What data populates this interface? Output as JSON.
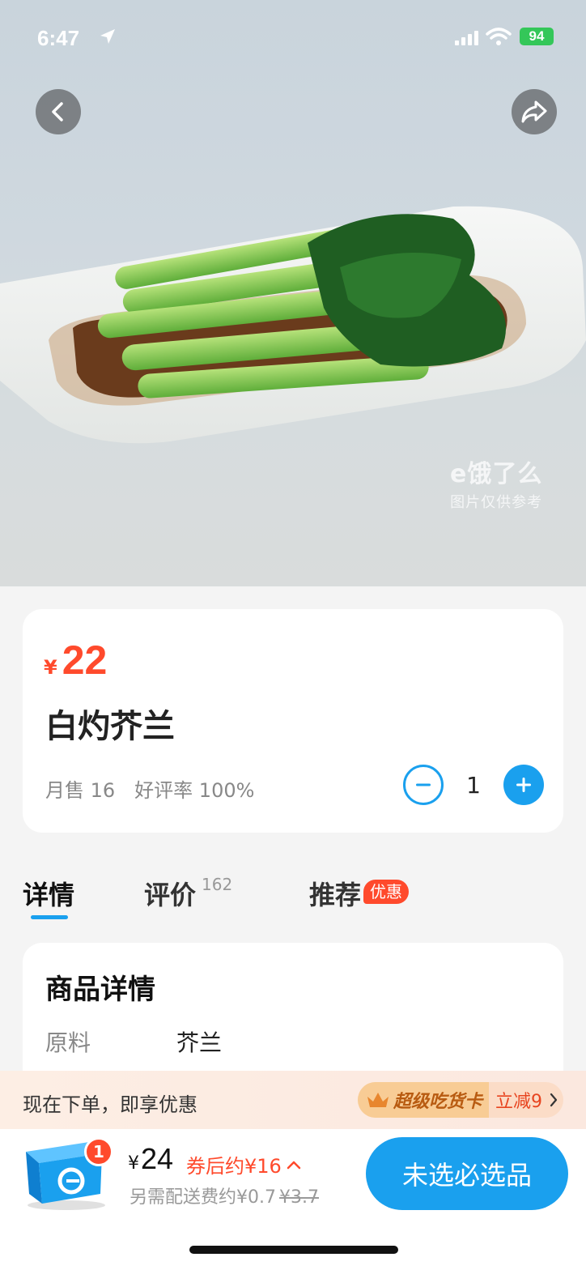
{
  "status_bar": {
    "time": "6:47",
    "battery": "94"
  },
  "hero": {
    "watermark_logo": "e饿了么",
    "watermark_caption": "图片仅供参考"
  },
  "product": {
    "currency": "¥",
    "price": "22",
    "name": "白灼芥兰",
    "monthly_sales": "月售 16",
    "rating": "好评率 100%",
    "quantity": "1"
  },
  "tabs": {
    "details": "详情",
    "reviews": "评价",
    "reviews_count": "162",
    "recommend": "推荐",
    "recommend_badge": "优惠"
  },
  "details": {
    "title": "商品详情",
    "ingredient_label": "原料",
    "ingredient_value": "芥兰"
  },
  "promo": {
    "text": "现在下单，即享优惠",
    "card_label": "超级吃货卡",
    "discount": "立减9"
  },
  "cart": {
    "badge": "1",
    "currency": "¥",
    "total": "24",
    "after_coupon": "券后约¥16",
    "delivery_fee": "另需配送费约¥0.7",
    "delivery_original": "¥3.7",
    "checkout_label": "未选必选品"
  },
  "colors": {
    "accent": "#1aa0ee",
    "price": "#ff4a2c"
  }
}
